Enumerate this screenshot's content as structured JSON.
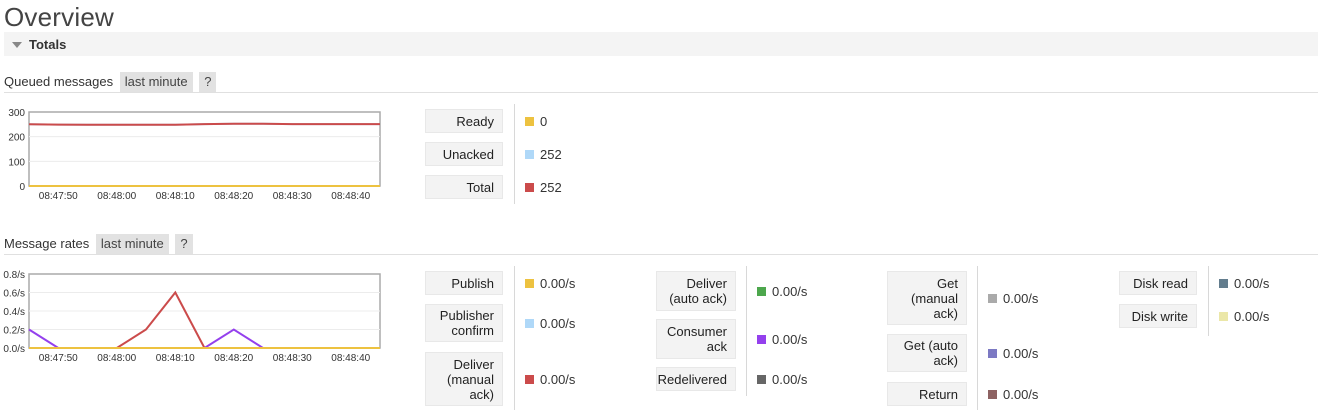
{
  "page": {
    "title": "Overview"
  },
  "section": {
    "label": "Totals"
  },
  "queued": {
    "heading": "Queued messages",
    "range_pill": "last minute",
    "help": "?",
    "legend": [
      {
        "label": "Ready",
        "value": "0",
        "color": "#edc240"
      },
      {
        "label": "Unacked",
        "value": "252",
        "color": "#afd8f8"
      },
      {
        "label": "Total",
        "value": "252",
        "color": "#cb4b4b"
      }
    ]
  },
  "rates": {
    "heading": "Message rates",
    "range_pill": "last minute",
    "help": "?",
    "col1": [
      {
        "label": "Publish",
        "value": "0.00/s",
        "color": "#edc240"
      },
      {
        "label": "Publisher confirm",
        "value": "0.00/s",
        "color": "#afd8f8"
      },
      {
        "label": "Deliver (manual ack)",
        "value": "0.00/s",
        "color": "#cb4b4b"
      }
    ],
    "col2": [
      {
        "label": "Deliver (auto ack)",
        "value": "0.00/s",
        "color": "#4da74d"
      },
      {
        "label": "Consumer ack",
        "value": "0.00/s",
        "color": "#9440ed"
      },
      {
        "label": "Redelivered",
        "value": "0.00/s",
        "color": "#666666"
      }
    ],
    "col3": [
      {
        "label": "Get (manual ack)",
        "value": "0.00/s",
        "color": "#aaaaaa"
      },
      {
        "label": "Get (auto ack)",
        "value": "0.00/s",
        "color": "#7c79c3"
      },
      {
        "label": "Return",
        "value": "0.00/s",
        "color": "#8d6262"
      }
    ],
    "col4": [
      {
        "label": "Disk read",
        "value": "0.00/s",
        "color": "#637d8e"
      },
      {
        "label": "Disk write",
        "value": "0.00/s",
        "color": "#ebe7a8"
      }
    ]
  },
  "chart_data": [
    {
      "type": "line",
      "x": [
        "08:47:45",
        "08:47:50",
        "08:47:55",
        "08:48:00",
        "08:48:05",
        "08:48:10",
        "08:48:15",
        "08:48:20",
        "08:48:25",
        "08:48:30",
        "08:48:35",
        "08:48:40",
        "08:48:45"
      ],
      "xticks": [
        "08:47:50",
        "08:48:00",
        "08:48:10",
        "08:48:20",
        "08:48:30",
        "08:48:40"
      ],
      "yticks": [
        "300",
        "200",
        "100",
        "0"
      ],
      "ylim": [
        0,
        300
      ],
      "series": [
        {
          "name": "Ready",
          "color": "#edc240",
          "values": [
            0,
            0,
            0,
            0,
            0,
            0,
            0,
            0,
            0,
            0,
            0,
            0,
            0
          ]
        },
        {
          "name": "Unacked",
          "color": "#afd8f8",
          "values": [
            250,
            249,
            248,
            248,
            248,
            248,
            251,
            252,
            252,
            251,
            251,
            251,
            251
          ]
        },
        {
          "name": "Total",
          "color": "#cb4b4b",
          "values": [
            250,
            249,
            248,
            248,
            248,
            248,
            251,
            252,
            252,
            251,
            251,
            251,
            251
          ]
        }
      ]
    },
    {
      "type": "line",
      "x": [
        "08:47:45",
        "08:47:50",
        "08:47:55",
        "08:48:00",
        "08:48:05",
        "08:48:10",
        "08:48:15",
        "08:48:20",
        "08:48:25",
        "08:48:30",
        "08:48:35",
        "08:48:40",
        "08:48:45"
      ],
      "xticks": [
        "08:47:50",
        "08:48:00",
        "08:48:10",
        "08:48:20",
        "08:48:30",
        "08:48:40"
      ],
      "yticks": [
        "0.8/s",
        "0.6/s",
        "0.4/s",
        "0.2/s",
        "0.0/s"
      ],
      "ylim": [
        0,
        0.8
      ],
      "series": [
        {
          "name": "Deliver (manual ack)",
          "color": "#cb4b4b",
          "values": [
            0,
            0,
            0,
            0,
            0.2,
            0.6,
            0,
            0,
            0,
            0,
            0,
            0,
            0
          ]
        },
        {
          "name": "Consumer ack",
          "color": "#9440ed",
          "values": [
            0.2,
            0,
            0,
            0,
            0,
            0,
            0,
            0.2,
            0,
            0,
            0,
            0,
            0
          ]
        },
        {
          "name": "Publish",
          "color": "#edc240",
          "values": [
            0,
            0,
            0,
            0,
            0,
            0,
            0,
            0,
            0,
            0,
            0,
            0,
            0
          ]
        }
      ]
    }
  ]
}
